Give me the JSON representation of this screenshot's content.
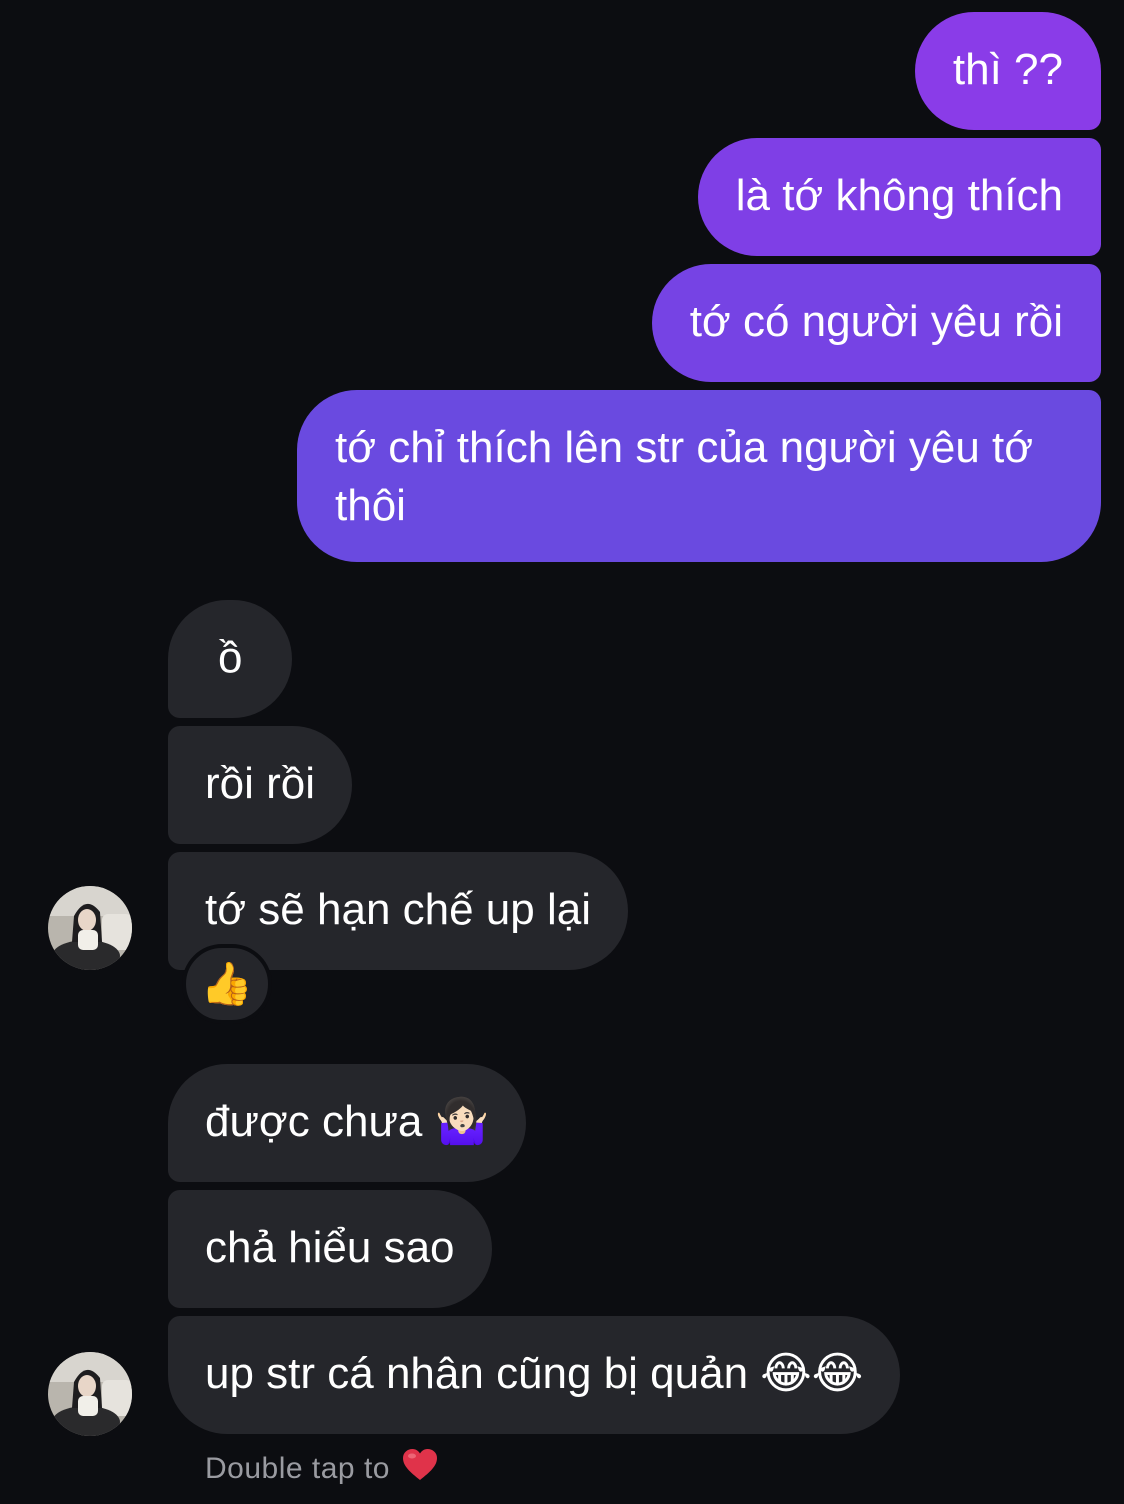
{
  "conversation": {
    "sent": [
      {
        "text": "thì ??"
      },
      {
        "text": "là tớ không thích"
      },
      {
        "text": "tớ có người yêu rồi"
      },
      {
        "text": "tớ chỉ thích lên str của người yêu tớ thôi"
      }
    ],
    "received": [
      {
        "text": "ồ"
      },
      {
        "text": "rồi rồi"
      },
      {
        "text": "tớ sẽ hạn chế up lại",
        "reaction": "👍"
      },
      {
        "text": "được chưa 🤷🏻‍♀️"
      },
      {
        "text": "chả hiểu sao"
      },
      {
        "text": "up str cá nhân cũng bị quản 😂😂"
      }
    ],
    "footer_hint": "Double tap to",
    "footer_icon": "red-heart-icon"
  },
  "colors": {
    "background": "#0c0d11",
    "sent_bubble_top": "#8a3ce8",
    "sent_bubble_bottom": "#6a4ae0",
    "received_bubble": "#25262b",
    "hint_text": "#9a9ba1",
    "heart": "#e0334a"
  }
}
